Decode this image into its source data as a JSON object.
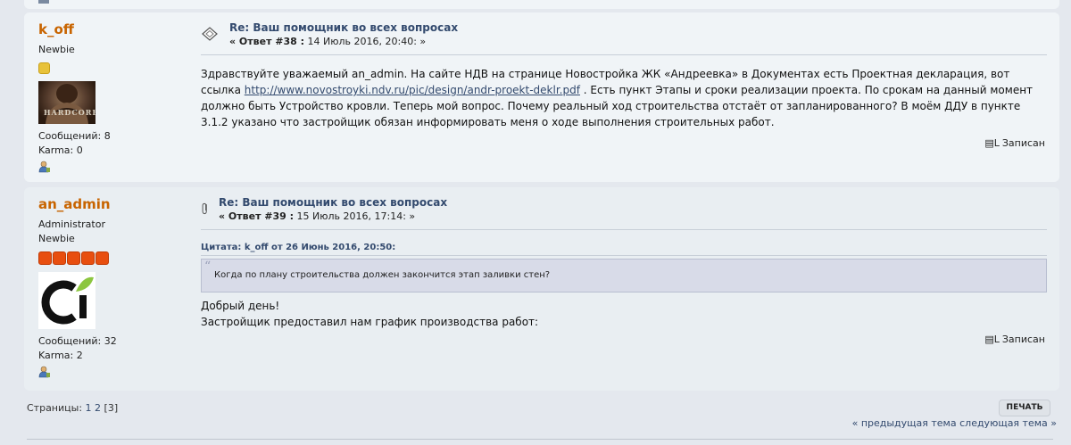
{
  "colors": {
    "username": "#c86400",
    "link": "#334a6e",
    "rank_star_newbie": "#e8c23a",
    "rank_star_admin": "#e84e0f",
    "quote_bg": "#d8dbe8"
  },
  "posts": [
    {
      "username": "k_off",
      "rank": "Newbie",
      "stars": 1,
      "avatar_text": "HARDCORE",
      "posts_label": "Сообщений: 8",
      "karma_label": "Karma: 0",
      "icon": "topic-arrow-icon",
      "subject": "Re: Ваш помощник во всех вопросах",
      "reply_label": "« Ответ #38 :",
      "date": "14 Июль 2016, 20:40: »",
      "text_before_link": "Здравствуйте уважаемый an_admin. На сайте НДВ на странице Новостройка ЖК «Андреевка» в Документах есть Проектная декларация, вот ссылка ",
      "link": "http://www.novostroyki.ndv.ru/pic/design/andr-proekt-deklr.pdf",
      "text_after_link": " . Есть пункт Этапы и сроки реализации проекта. По срокам на данный момент должно быть Устройство кровли. Теперь мой вопрос. Почему реальный ход строительства отстаёт от запланированного? В моём ДДУ в пункте 3.1.2 указано что застройщик обязан информировать меня о ходе выполнения строительных работ.",
      "reported": "Записан"
    },
    {
      "username": "an_admin",
      "rank_1": "Administrator",
      "rank_2": "Newbie",
      "stars": 5,
      "posts_label": "Сообщений: 32",
      "karma_label": "Karma: 2",
      "icon": "paperclip-icon",
      "subject": "Re: Ваш помощник во всех вопросах",
      "reply_label": "« Ответ #39 :",
      "date": "15 Июль 2016, 17:14: »",
      "quote_header": "Цитата: k_off от 26 Июнь 2016, 20:50:",
      "quote_text": "Когда по плану строительства должен закончится этап заливки стен?",
      "text_line_1": "Добрый день!",
      "text_line_2": "Застройщик предоставил нам график производства работ:",
      "reported": "Записан"
    }
  ],
  "pagination": {
    "label": "Страницы:",
    "page_1": "1",
    "page_2": "2",
    "current": "[3]"
  },
  "print_label": "ПЕЧАТЬ",
  "nav": {
    "prev": "« предыдущая тема",
    "next": "следующая тема »"
  }
}
